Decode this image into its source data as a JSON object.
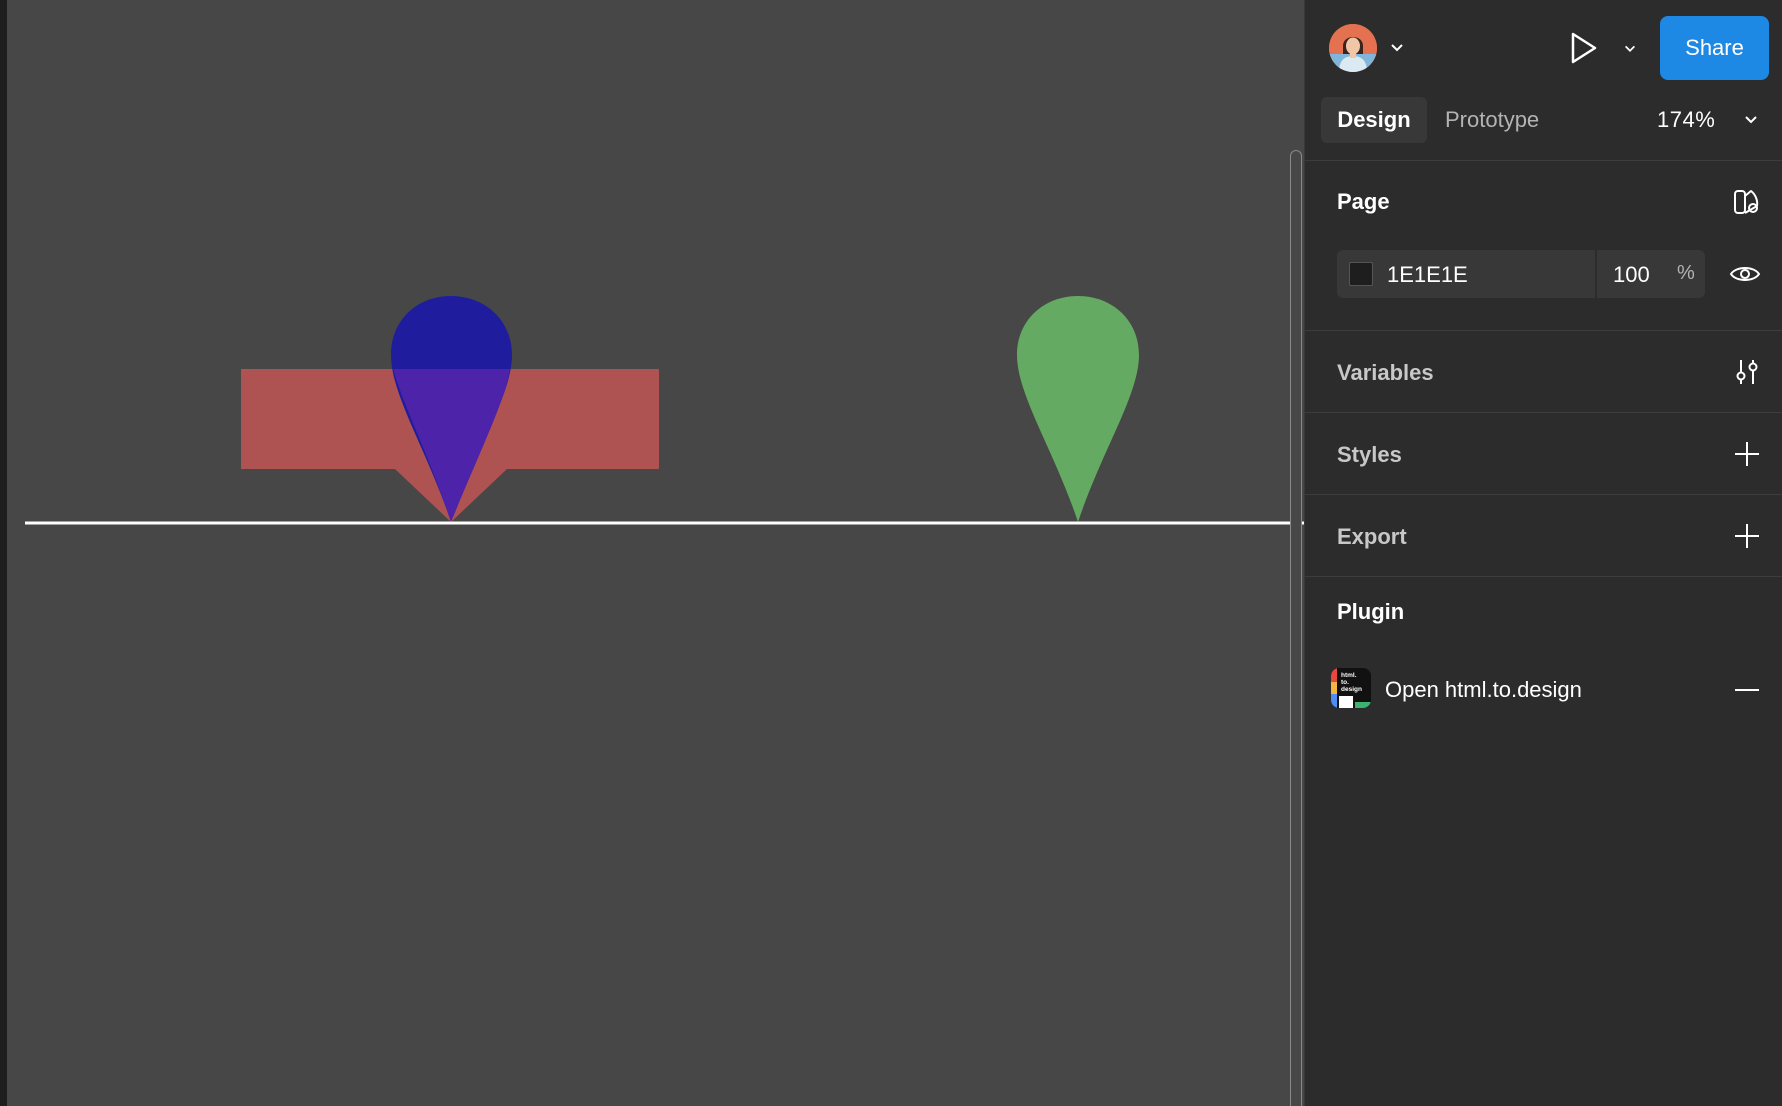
{
  "header": {
    "share_label": "Share"
  },
  "tabs": {
    "design_label": "Design",
    "prototype_label": "Prototype",
    "zoom_label": "174%"
  },
  "page_section": {
    "title": "Page",
    "color_hex": "1E1E1E",
    "opacity_value": "100",
    "opacity_unit": "%"
  },
  "sections": {
    "variables_title": "Variables",
    "styles_title": "Styles",
    "export_title": "Export",
    "plugin_title": "Plugin"
  },
  "plugin": {
    "item_label": "Open html.to.design",
    "icon_text": "html. to. design"
  },
  "colors": {
    "canvas_bg": "#474747",
    "panel_bg": "#2c2c2c",
    "share_blue": "#1e88e5",
    "rect_fill": "#af5352",
    "blue_pin": "#1f1d9e",
    "green_pin": "#65aa63"
  },
  "icons": {
    "avatar": "user-avatar",
    "play": "play-icon",
    "chevron": "chevron-down-icon",
    "libraries": "library-icon",
    "visibility": "eye-icon",
    "variables": "sliders-icon",
    "add": "plus-icon",
    "remove": "minus-icon"
  }
}
